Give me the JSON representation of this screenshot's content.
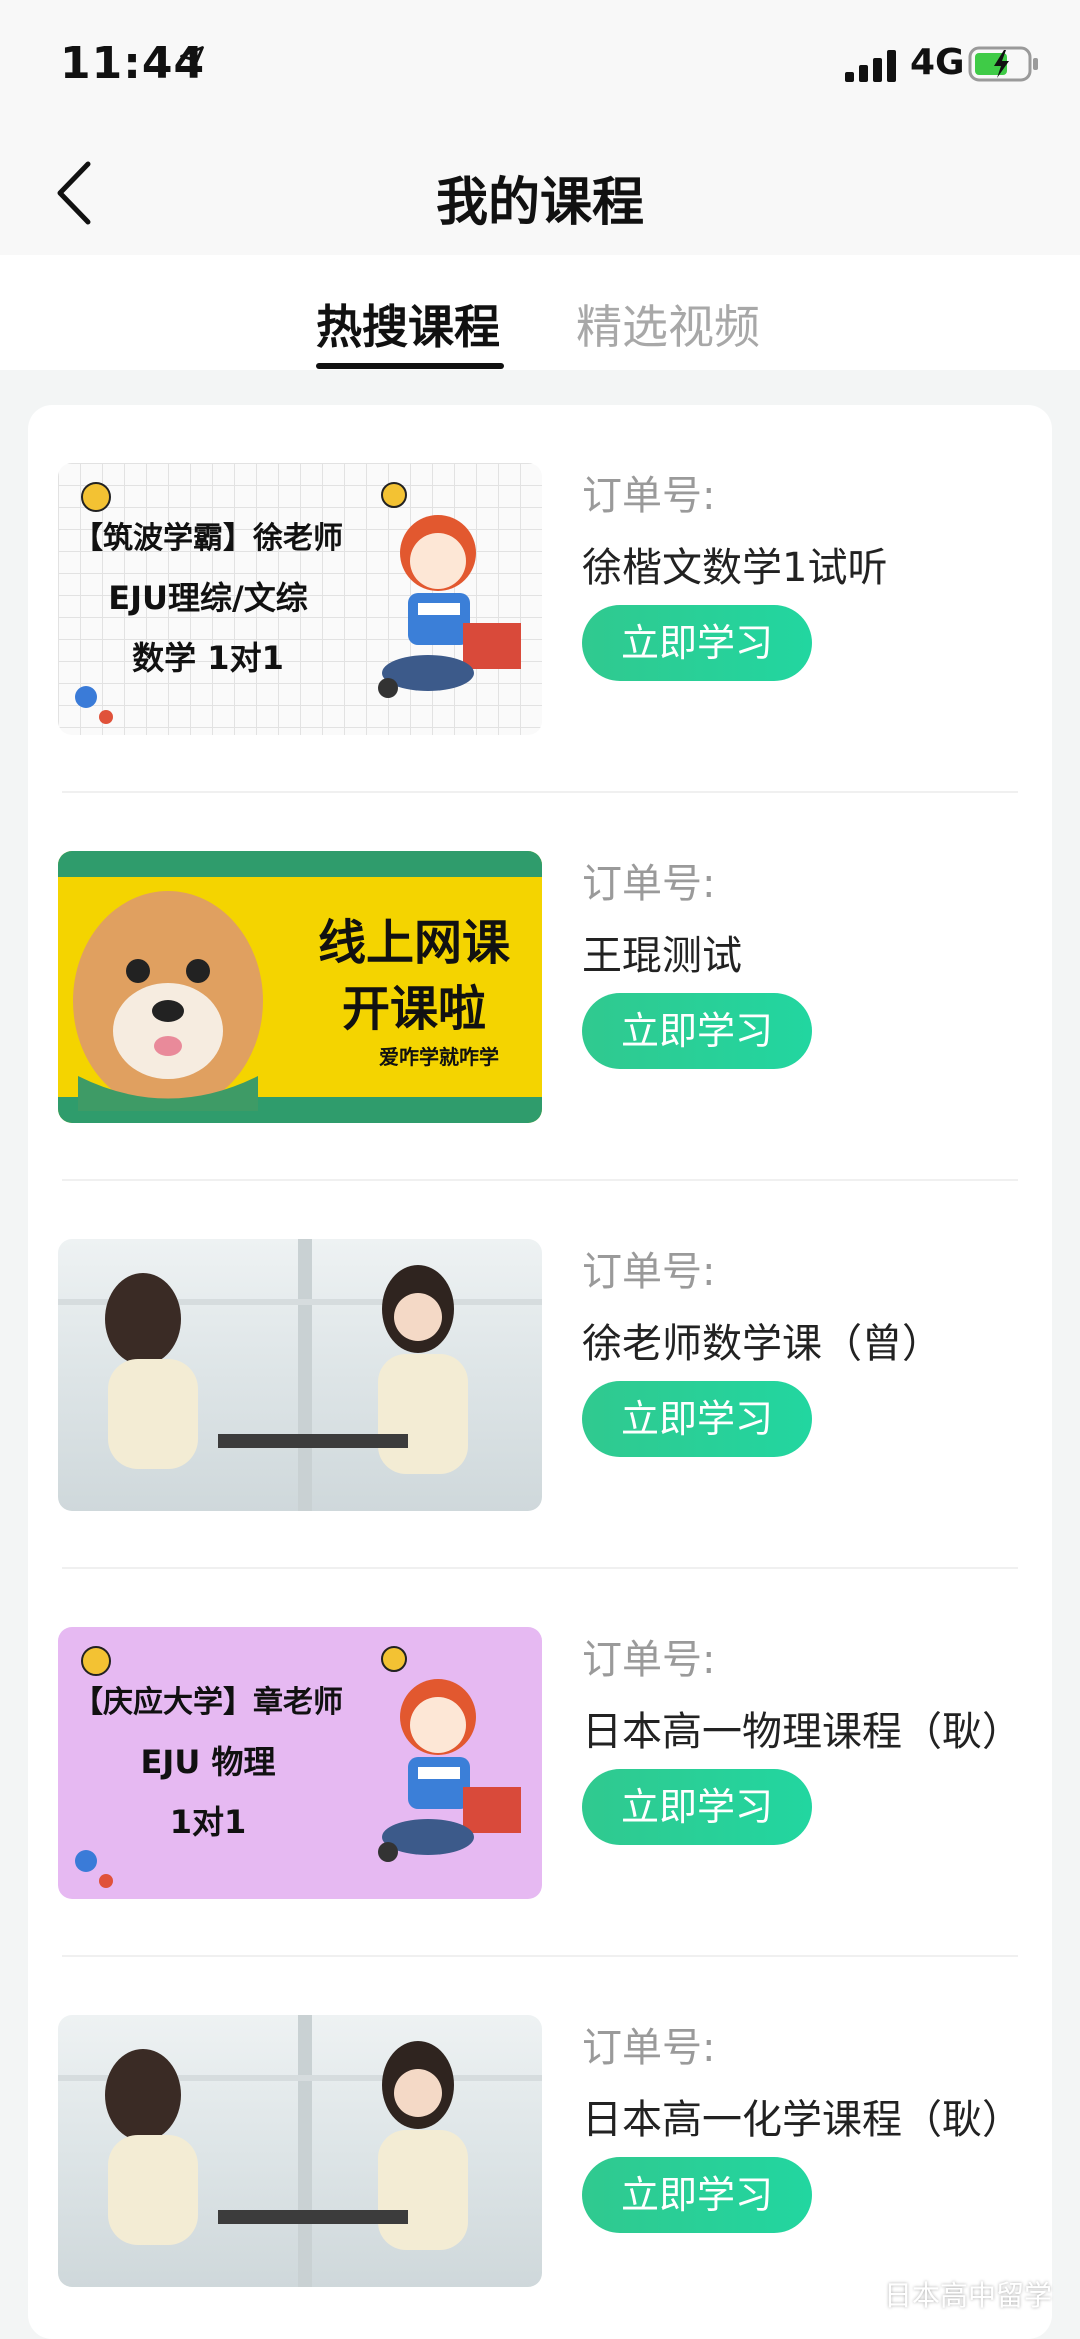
{
  "status_bar": {
    "time": "11:44",
    "network": "4G",
    "icons": [
      "location-arrow-icon",
      "signal-bars-icon",
      "battery-charging-icon"
    ]
  },
  "header": {
    "title": "我的课程",
    "back_icon": "chevron-left-icon"
  },
  "tabs": [
    {
      "label": "热搜课程",
      "active": true
    },
    {
      "label": "精选视频",
      "active": false
    }
  ],
  "courses": [
    {
      "order_label": "订单号:",
      "name": "徐楷文数学1试听",
      "button": "立即学习",
      "thumb": {
        "style": "grid",
        "lines": [
          "【筑波学霸】徐老师",
          "EJU理综/文综",
          "数学 1对1"
        ]
      }
    },
    {
      "order_label": "订单号:",
      "name": "王琨测试",
      "button": "立即学习",
      "thumb": {
        "style": "shiba",
        "lines": [
          "线上网课",
          "开课啦",
          "爱咋学就咋学"
        ]
      }
    },
    {
      "order_label": "订单号:",
      "name": "徐老师数学课（曾）",
      "button": "立即学习",
      "thumb": {
        "style": "photo",
        "lines": []
      }
    },
    {
      "order_label": "订单号:",
      "name": "日本高一物理课程（耿）",
      "button": "立即学习",
      "thumb": {
        "style": "purple",
        "lines": [
          "【庆应大学】章老师",
          "EJU 物理",
          "1对1"
        ]
      }
    },
    {
      "order_label": "订单号:",
      "name": "日本高一化学课程（耿）",
      "button": "立即学习",
      "thumb": {
        "style": "photo",
        "lines": []
      }
    }
  ],
  "watermark": "日本高中留学",
  "colors": {
    "accent": "#2ecf98",
    "background": "#f3f5f5",
    "card": "#ffffff",
    "muted_text": "#9a9a9a",
    "purple_thumb": "#e6b9f2",
    "yellow_thumb": "#f4d400"
  }
}
